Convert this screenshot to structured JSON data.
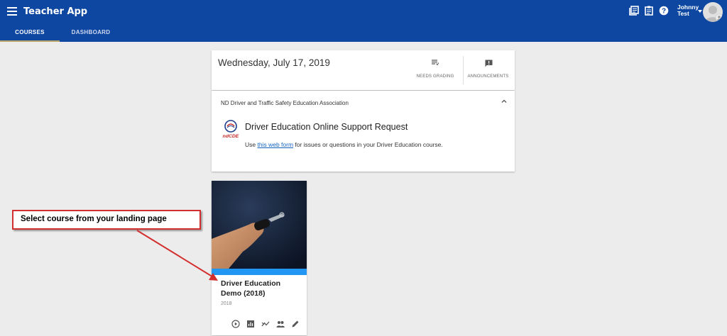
{
  "app": {
    "title": "Teacher App",
    "tabs": [
      {
        "label": "COURSES",
        "active": true
      },
      {
        "label": "DASHBOARD",
        "active": false
      }
    ],
    "user": {
      "first": "Johnny",
      "last": "Test"
    },
    "header_icons": [
      "library-icon",
      "clipboard-icon",
      "help-icon"
    ],
    "brand_color": "#0d47a1"
  },
  "date_card": {
    "date": "Wednesday, July 17, 2019",
    "actions": [
      {
        "label": "NEEDS GRADING",
        "icon": "needs-grading-icon"
      },
      {
        "label": "ANNOUNCEMENTS",
        "icon": "announcement-icon"
      }
    ]
  },
  "info_card": {
    "org": "ND Driver and Traffic Safety Education Association",
    "logo_text": "ndCDE",
    "title": "Driver Education Online Support Request",
    "text_before": "Use ",
    "link": "this web form",
    "text_after": " for issues or questions in your Driver Education course."
  },
  "course": {
    "title": "Driver Education Demo (2018)",
    "year": "2018",
    "accent": "#2196f3",
    "actions": [
      "play-icon",
      "gradebook-icon",
      "analytics-icon",
      "people-icon",
      "edit-icon"
    ]
  },
  "annotation": {
    "text": "Select course from your landing page",
    "color": "#d32f2f"
  }
}
